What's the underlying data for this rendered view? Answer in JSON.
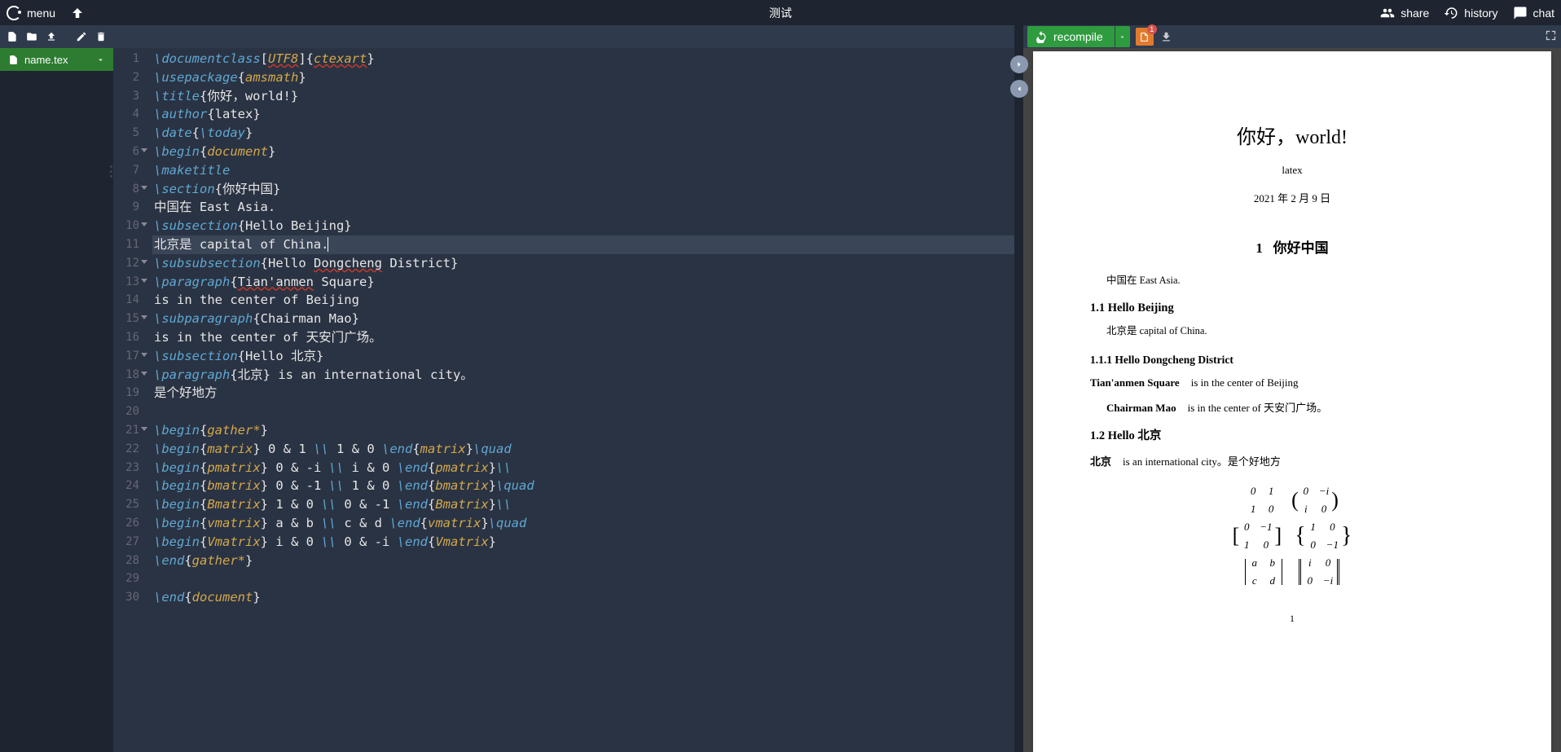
{
  "header": {
    "menu_label": "menu",
    "title": "测试",
    "share_label": "share",
    "history_label": "history",
    "chat_label": "chat"
  },
  "sidebar": {
    "file_name": "name.tex"
  },
  "compile": {
    "button_label": "recompile",
    "badge_count": "1"
  },
  "editor": {
    "active_line": 11,
    "lines": [
      {
        "n": 1,
        "tokens": [
          {
            "t": "\\documentclass",
            "c": "kw"
          },
          {
            "t": "[",
            "c": "txt"
          },
          {
            "t": "UTF8",
            "c": "arg err"
          },
          {
            "t": "]{",
            "c": "txt"
          },
          {
            "t": "ctexart",
            "c": "arg err"
          },
          {
            "t": "}",
            "c": "txt"
          }
        ]
      },
      {
        "n": 2,
        "tokens": [
          {
            "t": "\\usepackage",
            "c": "kw"
          },
          {
            "t": "{",
            "c": "txt"
          },
          {
            "t": "amsmath",
            "c": "arg"
          },
          {
            "t": "}",
            "c": "txt"
          }
        ]
      },
      {
        "n": 3,
        "tokens": [
          {
            "t": "\\title",
            "c": "kw"
          },
          {
            "t": "{你好，world!}",
            "c": "txt"
          }
        ]
      },
      {
        "n": 4,
        "tokens": [
          {
            "t": "\\author",
            "c": "kw"
          },
          {
            "t": "{latex}",
            "c": "txt"
          }
        ]
      },
      {
        "n": 5,
        "tokens": [
          {
            "t": "\\date",
            "c": "kw"
          },
          {
            "t": "{",
            "c": "txt"
          },
          {
            "t": "\\today",
            "c": "kw"
          },
          {
            "t": "}",
            "c": "txt"
          }
        ]
      },
      {
        "n": 6,
        "fold": true,
        "tokens": [
          {
            "t": "\\begin",
            "c": "kw"
          },
          {
            "t": "{",
            "c": "txt"
          },
          {
            "t": "document",
            "c": "arg"
          },
          {
            "t": "}",
            "c": "txt"
          }
        ]
      },
      {
        "n": 7,
        "tokens": [
          {
            "t": "\\maketitle",
            "c": "kw"
          }
        ]
      },
      {
        "n": 8,
        "fold": true,
        "tokens": [
          {
            "t": "\\section",
            "c": "kw"
          },
          {
            "t": "{你好中国}",
            "c": "txt"
          }
        ]
      },
      {
        "n": 9,
        "tokens": [
          {
            "t": "中国在 East Asia.",
            "c": "txt"
          }
        ]
      },
      {
        "n": 10,
        "fold": true,
        "tokens": [
          {
            "t": "\\subsection",
            "c": "kw"
          },
          {
            "t": "{Hello Beijing}",
            "c": "txt"
          }
        ]
      },
      {
        "n": 11,
        "cursor": true,
        "tokens": [
          {
            "t": "北京是 capital of China.",
            "c": "txt"
          }
        ]
      },
      {
        "n": 12,
        "fold": true,
        "tokens": [
          {
            "t": "\\subsubsection",
            "c": "kw"
          },
          {
            "t": "{Hello ",
            "c": "txt"
          },
          {
            "t": "Dongcheng",
            "c": "txt err"
          },
          {
            "t": " District}",
            "c": "txt"
          }
        ]
      },
      {
        "n": 13,
        "fold": true,
        "tokens": [
          {
            "t": "\\paragraph",
            "c": "kw"
          },
          {
            "t": "{",
            "c": "txt"
          },
          {
            "t": "Tian'anmen",
            "c": "txt err"
          },
          {
            "t": " Square}",
            "c": "txt"
          }
        ]
      },
      {
        "n": 14,
        "tokens": [
          {
            "t": "is in the center of Beijing",
            "c": "txt"
          }
        ]
      },
      {
        "n": 15,
        "fold": true,
        "tokens": [
          {
            "t": "\\subparagraph",
            "c": "kw"
          },
          {
            "t": "{Chairman Mao}",
            "c": "txt"
          }
        ]
      },
      {
        "n": 16,
        "tokens": [
          {
            "t": "is in the center of 天安门广场。",
            "c": "txt"
          }
        ]
      },
      {
        "n": 17,
        "fold": true,
        "tokens": [
          {
            "t": "\\subsection",
            "c": "kw"
          },
          {
            "t": "{Hello 北京}",
            "c": "txt"
          }
        ]
      },
      {
        "n": 18,
        "fold": true,
        "tokens": [
          {
            "t": "\\paragraph",
            "c": "kw"
          },
          {
            "t": "{北京} is an international city。",
            "c": "txt"
          }
        ]
      },
      {
        "n": 19,
        "tokens": [
          {
            "t": "是个好地方",
            "c": "txt"
          }
        ]
      },
      {
        "n": 20,
        "tokens": []
      },
      {
        "n": 21,
        "fold": true,
        "tokens": [
          {
            "t": "\\begin",
            "c": "kw"
          },
          {
            "t": "{",
            "c": "txt"
          },
          {
            "t": "gather*",
            "c": "arg"
          },
          {
            "t": "}",
            "c": "txt"
          }
        ]
      },
      {
        "n": 22,
        "tokens": [
          {
            "t": "\\begin",
            "c": "kw"
          },
          {
            "t": "{",
            "c": "txt"
          },
          {
            "t": "matrix",
            "c": "arg"
          },
          {
            "t": "} 0 & 1 ",
            "c": "txt"
          },
          {
            "t": "\\\\",
            "c": "kw"
          },
          {
            "t": " 1 & 0 ",
            "c": "txt"
          },
          {
            "t": "\\end",
            "c": "kw"
          },
          {
            "t": "{",
            "c": "txt"
          },
          {
            "t": "matrix",
            "c": "arg"
          },
          {
            "t": "}",
            "c": "txt"
          },
          {
            "t": "\\quad",
            "c": "kw"
          }
        ]
      },
      {
        "n": 23,
        "tokens": [
          {
            "t": "\\begin",
            "c": "kw"
          },
          {
            "t": "{",
            "c": "txt"
          },
          {
            "t": "pmatrix",
            "c": "arg"
          },
          {
            "t": "} 0 & -i ",
            "c": "txt"
          },
          {
            "t": "\\\\",
            "c": "kw"
          },
          {
            "t": " i & 0 ",
            "c": "txt"
          },
          {
            "t": "\\end",
            "c": "kw"
          },
          {
            "t": "{",
            "c": "txt"
          },
          {
            "t": "pmatrix",
            "c": "arg"
          },
          {
            "t": "}",
            "c": "txt"
          },
          {
            "t": "\\\\",
            "c": "kw"
          }
        ]
      },
      {
        "n": 24,
        "tokens": [
          {
            "t": "\\begin",
            "c": "kw"
          },
          {
            "t": "{",
            "c": "txt"
          },
          {
            "t": "bmatrix",
            "c": "arg"
          },
          {
            "t": "} 0 & -1 ",
            "c": "txt"
          },
          {
            "t": "\\\\",
            "c": "kw"
          },
          {
            "t": " 1 & 0 ",
            "c": "txt"
          },
          {
            "t": "\\end",
            "c": "kw"
          },
          {
            "t": "{",
            "c": "txt"
          },
          {
            "t": "bmatrix",
            "c": "arg"
          },
          {
            "t": "}",
            "c": "txt"
          },
          {
            "t": "\\quad",
            "c": "kw"
          }
        ]
      },
      {
        "n": 25,
        "tokens": [
          {
            "t": "\\begin",
            "c": "kw"
          },
          {
            "t": "{",
            "c": "txt"
          },
          {
            "t": "Bmatrix",
            "c": "arg"
          },
          {
            "t": "} 1 & 0 ",
            "c": "txt"
          },
          {
            "t": "\\\\",
            "c": "kw"
          },
          {
            "t": " 0 & -1 ",
            "c": "txt"
          },
          {
            "t": "\\end",
            "c": "kw"
          },
          {
            "t": "{",
            "c": "txt"
          },
          {
            "t": "Bmatrix",
            "c": "arg"
          },
          {
            "t": "}",
            "c": "txt"
          },
          {
            "t": "\\\\",
            "c": "kw"
          }
        ]
      },
      {
        "n": 26,
        "tokens": [
          {
            "t": "\\begin",
            "c": "kw"
          },
          {
            "t": "{",
            "c": "txt"
          },
          {
            "t": "vmatrix",
            "c": "arg"
          },
          {
            "t": "} a & b ",
            "c": "txt"
          },
          {
            "t": "\\\\",
            "c": "kw"
          },
          {
            "t": " c & d ",
            "c": "txt"
          },
          {
            "t": "\\end",
            "c": "kw"
          },
          {
            "t": "{",
            "c": "txt"
          },
          {
            "t": "vmatrix",
            "c": "arg"
          },
          {
            "t": "}",
            "c": "txt"
          },
          {
            "t": "\\quad",
            "c": "kw"
          }
        ]
      },
      {
        "n": 27,
        "tokens": [
          {
            "t": "\\begin",
            "c": "kw"
          },
          {
            "t": "{",
            "c": "txt"
          },
          {
            "t": "Vmatrix",
            "c": "arg"
          },
          {
            "t": "} i & 0 ",
            "c": "txt"
          },
          {
            "t": "\\\\",
            "c": "kw"
          },
          {
            "t": " 0 & -i ",
            "c": "txt"
          },
          {
            "t": "\\end",
            "c": "kw"
          },
          {
            "t": "{",
            "c": "txt"
          },
          {
            "t": "Vmatrix",
            "c": "arg"
          },
          {
            "t": "}",
            "c": "txt"
          }
        ]
      },
      {
        "n": 28,
        "tokens": [
          {
            "t": "\\end",
            "c": "kw"
          },
          {
            "t": "{",
            "c": "txt"
          },
          {
            "t": "gather*",
            "c": "arg"
          },
          {
            "t": "}",
            "c": "txt"
          }
        ]
      },
      {
        "n": 29,
        "tokens": []
      },
      {
        "n": 30,
        "tokens": [
          {
            "t": "\\end",
            "c": "kw"
          },
          {
            "t": "{",
            "c": "txt"
          },
          {
            "t": "document",
            "c": "arg"
          },
          {
            "t": "}",
            "c": "txt"
          }
        ]
      }
    ]
  },
  "preview": {
    "title": "你好，world!",
    "author": "latex",
    "date": "2021 年 2 月 9 日",
    "section1_num": "1",
    "section1_title": "你好中国",
    "p1": "中国在 East Asia.",
    "sub11": "1.1   Hello Beijing",
    "p2": "北京是 capital of China.",
    "sub111": "1.1.1   Hello Dongcheng District",
    "para1_label": "Tian'anmen Square",
    "para1_text": "is in the center of Beijing",
    "subpara_label": "Chairman Mao",
    "subpara_text": "is in the center of 天安门广场。",
    "sub12": "1.2   Hello 北京",
    "para2_label": "北京",
    "para2_text": "is an international city。是个好地方",
    "matrices": {
      "m1": [
        "0",
        "1",
        "1",
        "0"
      ],
      "m2": [
        "0",
        "−i",
        "i",
        "0"
      ],
      "m3": [
        "0",
        "−1",
        "1",
        "0"
      ],
      "m4": [
        "1",
        "0",
        "0",
        "−1"
      ],
      "m5": [
        "a",
        "b",
        "c",
        "d"
      ],
      "m6": [
        "i",
        "0",
        "0",
        "−i"
      ]
    },
    "page_num": "1"
  }
}
